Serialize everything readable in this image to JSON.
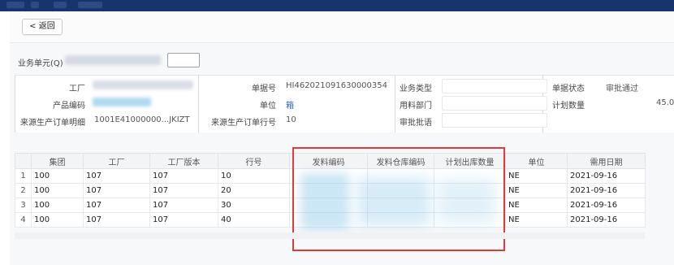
{
  "toolbar": {
    "back_label": "< 返回"
  },
  "business_unit": {
    "label": "业务单元(Q)",
    "value": ""
  },
  "header_fields": {
    "factory": {
      "label": "工厂",
      "value": ""
    },
    "product_code": {
      "label": "产品编码",
      "value": ""
    },
    "source_order_detail": {
      "label": "来源生产订单明细",
      "value": "1001E41000000...JKIZT"
    },
    "doc_no": {
      "label": "单据号",
      "value": "HI462021091630000354"
    },
    "unit": {
      "label": "单位",
      "value": "箱"
    },
    "source_order_line": {
      "label": "来源生产订单行号",
      "value": "10"
    },
    "biz_type": {
      "label": "业务类型",
      "value": ""
    },
    "use_dept": {
      "label": "用料部门",
      "value": ""
    },
    "approval_flow": {
      "label": "审批批语",
      "value": ""
    },
    "doc_status": {
      "label": "单据状态",
      "value": "审批通过"
    },
    "plan_qty": {
      "label": "计划数量",
      "value": "45.0"
    }
  },
  "table": {
    "columns": [
      "",
      "集团",
      "工厂",
      "工厂版本",
      "行号",
      "发料编码",
      "发料仓库编码",
      "计划出库数量",
      "单位",
      "需用日期"
    ],
    "rows": [
      {
        "idx": "1",
        "group": "100",
        "factory": "107",
        "version": "107",
        "line": "10",
        "unit": "NE",
        "date": "2021-09-16"
      },
      {
        "idx": "2",
        "group": "100",
        "factory": "107",
        "version": "107",
        "line": "20",
        "unit": "NE",
        "date": "2021-09-16"
      },
      {
        "idx": "3",
        "group": "100",
        "factory": "107",
        "version": "107",
        "line": "30",
        "unit": "NE",
        "date": "2021-09-16"
      },
      {
        "idx": "4",
        "group": "100",
        "factory": "107",
        "version": "107",
        "line": "40",
        "unit": "NE",
        "date": "2021-09-16"
      }
    ]
  },
  "colors": {
    "topbar": "#17346b",
    "highlight_border": "#e03a3a",
    "link": "#2b63c7"
  }
}
